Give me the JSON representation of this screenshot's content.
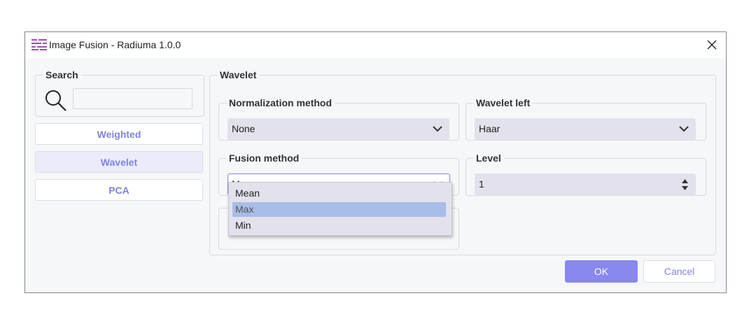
{
  "window": {
    "title": "Image Fusion - Radiuma 1.0.0"
  },
  "search": {
    "label": "Search",
    "value": ""
  },
  "nav": [
    {
      "label": "Weighted",
      "active": false
    },
    {
      "label": "Wavelet",
      "active": true
    },
    {
      "label": "PCA",
      "active": false
    }
  ],
  "panel": {
    "title": "Wavelet",
    "normalization": {
      "label": "Normalization method",
      "value": "None"
    },
    "wavelet_left": {
      "label": "Wavelet left",
      "value": "Haar"
    },
    "fusion": {
      "label": "Fusion method",
      "value": "Max",
      "options": [
        "Mean",
        "Max",
        "Min"
      ]
    },
    "level": {
      "label": "Level",
      "value": "1"
    }
  },
  "buttons": {
    "ok": "OK",
    "cancel": "Cancel"
  },
  "colors": {
    "accent": "#8888ee",
    "nav_text": "#7f83e0",
    "select_bg": "#e2e1ec",
    "dropdown_selected": "#a8bde8",
    "app_icon": "#9b4fb0"
  },
  "icons": {
    "app": "radiuma-app-icon",
    "close": "close-icon",
    "search": "search-icon",
    "chevron": "chevron-down-icon",
    "spin": "spin-arrows-icon"
  }
}
